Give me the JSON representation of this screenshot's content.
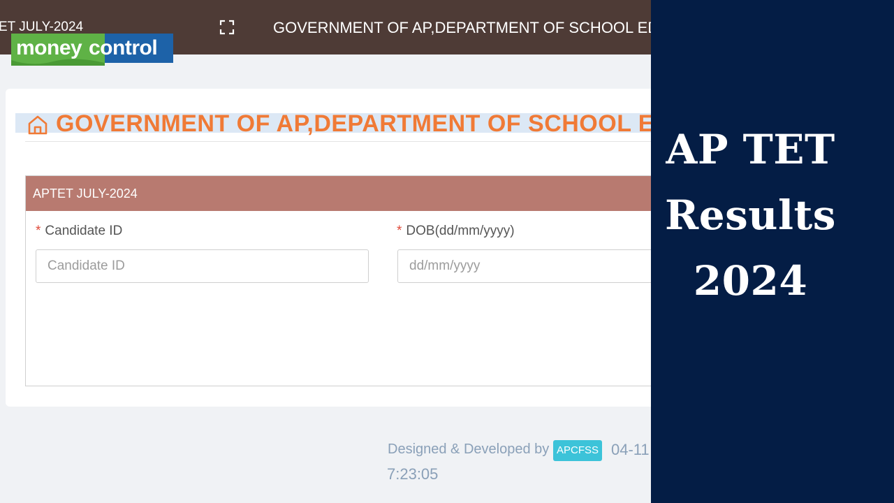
{
  "topbar": {
    "crumb": "ET JULY-2024",
    "title": "GOVERNMENT OF AP,DEPARTMENT OF SCHOOL EDU"
  },
  "logo": {
    "money": "money",
    "control": "control"
  },
  "heading": "GOVERNMENT OF AP,DEPARTMENT OF SCHOOL EDUCA",
  "panel": {
    "title": "APTET JULY-2024",
    "candidate_label": "Candidate ID",
    "candidate_placeholder": "Candidate ID",
    "dob_label": "DOB(dd/mm/yyyy)",
    "dob_placeholder": "dd/mm/yyyy",
    "required_mark": "*"
  },
  "footer": {
    "designed_by": "Designed & Developed by",
    "badge": "APCFSS",
    "date": "04-11",
    "time": "7:23:05"
  },
  "overlay": {
    "line1": "AP TET",
    "line2": "Results",
    "line3": "2024"
  },
  "colors": {
    "topbar": "#4e3b36",
    "heading_orange": "#f07a36",
    "panel_header": "#b87a70",
    "side_panel": "#041d45",
    "badge": "#3cc3d9",
    "logo_green": "#5fb246",
    "logo_blue": "#1d62a8"
  },
  "icons": {
    "fullscreen": "fullscreen-icon",
    "home": "home-icon"
  }
}
